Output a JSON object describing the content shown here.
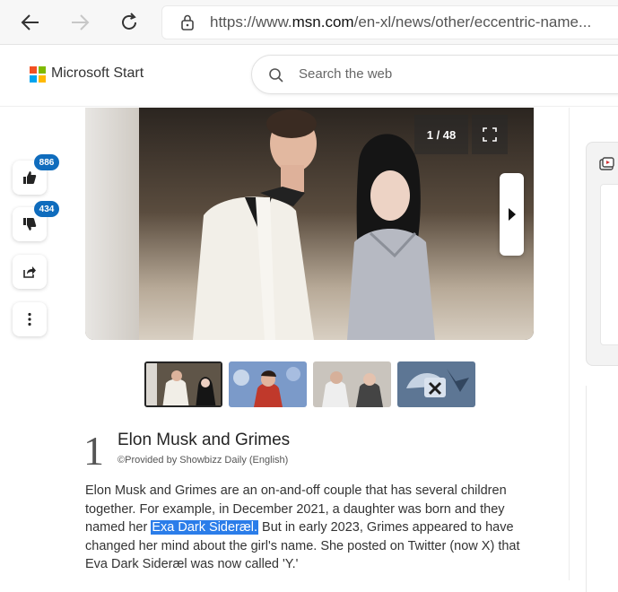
{
  "browser": {
    "url_prefix": "https://www.",
    "url_domain": "msn.com",
    "url_path": "/en-xl/news/other/eccentric-name..."
  },
  "header": {
    "brand": "Microsoft Start",
    "search_placeholder": "Search the web",
    "logo_colors": [
      "#f25022",
      "#7fba00",
      "#00a4ef",
      "#ffb900"
    ]
  },
  "reactions": {
    "like_count": "886",
    "dislike_count": "434"
  },
  "gallery": {
    "counter": "1 / 48"
  },
  "slide": {
    "number": "1",
    "title": "Elon Musk and Grimes",
    "provider": "©Provided by Showbizz Daily (English)",
    "text_before": "Elon Musk and Grimes are an on-and-off couple that has several children together. For example, in December 2021, a daughter was born and they named her ",
    "text_highlight": "Exa Dark Sideræl.",
    "text_after": " But in early 2023, Grimes appeared to have changed her mind about the girl's name. She posted on Twitter (now X) that Eva Dark Sideræl was now called 'Y.'"
  },
  "colors": {
    "accent": "#0f6cbd",
    "selection": "#2b7de9"
  }
}
